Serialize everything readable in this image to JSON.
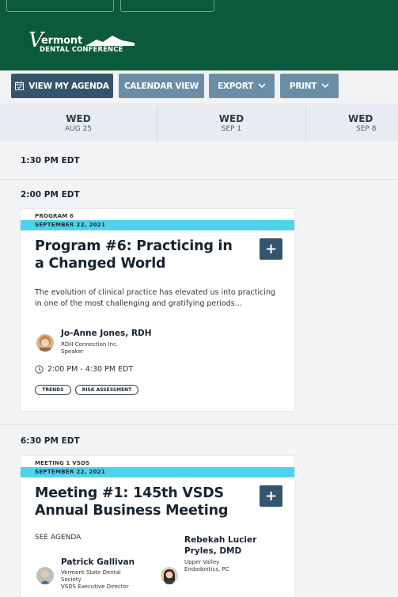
{
  "header": {
    "logo": {
      "letter": "V",
      "line1": "ermont",
      "line2": "DENTAL CONFERENCE"
    }
  },
  "toolbar": {
    "view_my_agenda": "VIEW MY AGENDA",
    "calendar_view": "CALENDAR VIEW",
    "export": "EXPORT",
    "print": "PRINT"
  },
  "dates": [
    {
      "dow": "WED",
      "date": "AUG 25"
    },
    {
      "dow": "WED",
      "date": "SEP 1"
    },
    {
      "dow": "WED",
      "date": "SEP 8"
    }
  ],
  "timeslots": [
    "1:30 PM EDT",
    "2:00 PM EDT",
    "6:30 PM EDT"
  ],
  "sessions": [
    {
      "type": "PROGRAM 6",
      "date": "SEPTEMBER 22, 2021",
      "title": "Program #6: Practicing in a Changed World",
      "add": "+",
      "description": "The evolution of clinical practice has elevated us into practicing in one of the most challenging and gratifying periods...",
      "speakers": [
        {
          "name": "Jo-Anne Jones, RDH",
          "org": "RDH Connection Inc.",
          "role": "Speaker"
        }
      ],
      "time": "2:00 PM - 4:30 PM EDT",
      "tags": [
        "TRENDS",
        "RISK ASSESSMENT"
      ]
    },
    {
      "type": "MEETING 1 VSDS",
      "date": "SEPTEMBER 22, 2021",
      "title": "Meeting #1: 145th VSDS Annual Business Meeting",
      "add": "+",
      "see_agenda": "SEE AGENDA",
      "speakers": [
        {
          "name": "Patrick Gallivan",
          "org_line1": "Vermont State Dental",
          "org_line2": "Society",
          "role": "VSDS Executive Director"
        },
        {
          "name_line1": "Rebekah Lucier",
          "name_line2": "Pryles, DMD",
          "org_line1": "Upper Valley",
          "org_line2": "Endodontics, PC"
        }
      ]
    }
  ],
  "colors": {
    "header_bg": "#0b5a3b",
    "button_dark": "#34556e",
    "button_mid": "#6b8ea7",
    "date_band": "#4fd2ec"
  }
}
